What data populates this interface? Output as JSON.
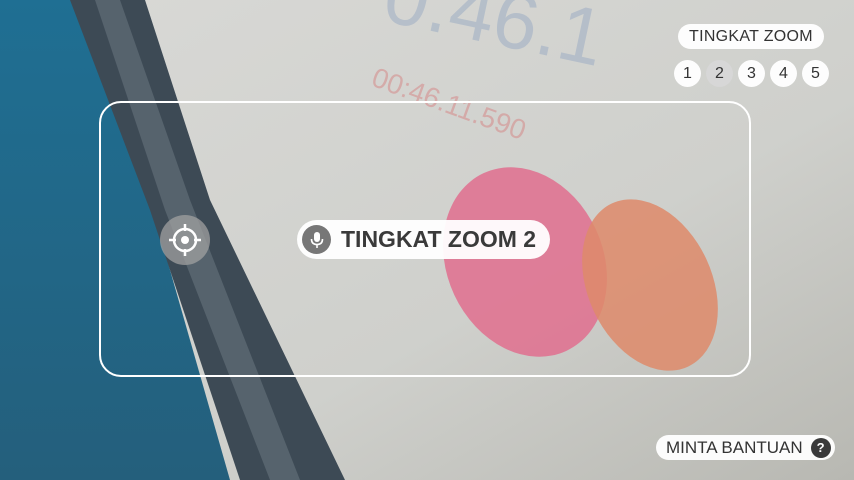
{
  "zoom_panel": {
    "title": "TINGKAT ZOOM",
    "levels": [
      "1",
      "2",
      "3",
      "4",
      "5"
    ],
    "selected": "2"
  },
  "status": {
    "text": "TINGKAT ZOOM 2",
    "icon": "microphone-icon"
  },
  "focus_target": {
    "icon": "crosshair-icon"
  },
  "help": {
    "label": "MINTA BANTUAN",
    "icon_glyph": "?"
  },
  "colors": {
    "frame": "#ffffff",
    "pill_bg": "#ffffff",
    "selected_level_bg": "#d7d7d7",
    "mic_circle": "#777777"
  }
}
